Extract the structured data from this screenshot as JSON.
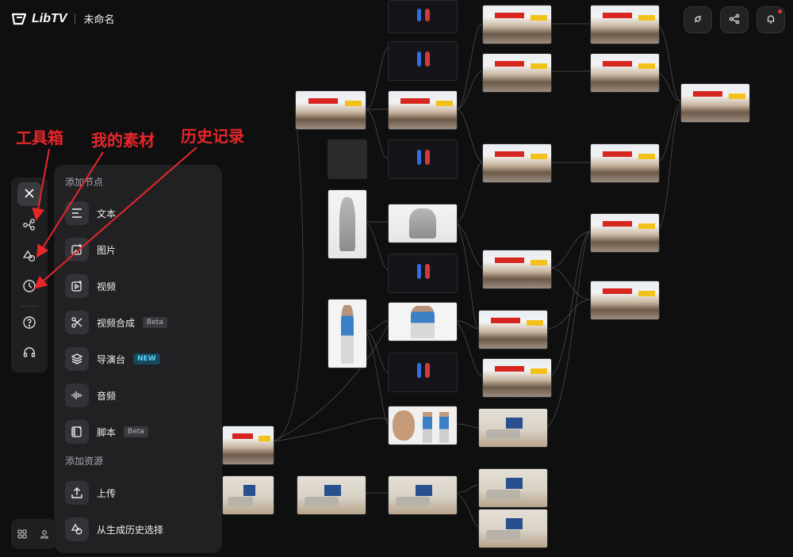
{
  "header": {
    "app_name": "LibTV",
    "document_title": "未命名",
    "actions": [
      {
        "name": "plugin-button",
        "icon": "plug-icon"
      },
      {
        "name": "share-button",
        "icon": "share-icon"
      },
      {
        "name": "notification-button",
        "icon": "bell-icon",
        "has_dot": true
      }
    ]
  },
  "toolbar": {
    "items": [
      {
        "name": "close-button",
        "icon": "close-icon",
        "active": true
      },
      {
        "name": "toolbox-button",
        "icon": "node-graph-icon"
      },
      {
        "name": "my-assets-button",
        "icon": "shapes-icon"
      },
      {
        "name": "history-button",
        "icon": "clock-icon"
      },
      {
        "name": "help-button",
        "icon": "help-circle-icon"
      },
      {
        "name": "support-button",
        "icon": "headset-icon"
      }
    ]
  },
  "panel": {
    "section_add_node": "添加节点",
    "section_add_resource": "添加资源",
    "node_items": [
      {
        "label": "文本",
        "icon": "text-lines-icon",
        "badge": ""
      },
      {
        "label": "图片",
        "icon": "image-plus-icon",
        "badge": ""
      },
      {
        "label": "视频",
        "icon": "video-plus-icon",
        "badge": ""
      },
      {
        "label": "视频合成",
        "icon": "scissors-icon",
        "badge": "Beta"
      },
      {
        "label": "导演台",
        "icon": "layers-icon",
        "badge": "NEW"
      },
      {
        "label": "音频",
        "icon": "audio-wave-icon",
        "badge": ""
      },
      {
        "label": "脚本",
        "icon": "film-script-icon",
        "badge": "Beta"
      }
    ],
    "resource_items": [
      {
        "label": "上传",
        "icon": "upload-icon"
      },
      {
        "label": "从生成历史选择",
        "icon": "history-shapes-icon"
      }
    ]
  },
  "annotations": {
    "toolbox": "工具箱",
    "my_assets": "我的素材",
    "history": "历史记录"
  },
  "colors": {
    "background": "#0f0f10",
    "panel": "#212124",
    "annotation_red": "#e8262a",
    "new_badge": "#54d3ff"
  }
}
